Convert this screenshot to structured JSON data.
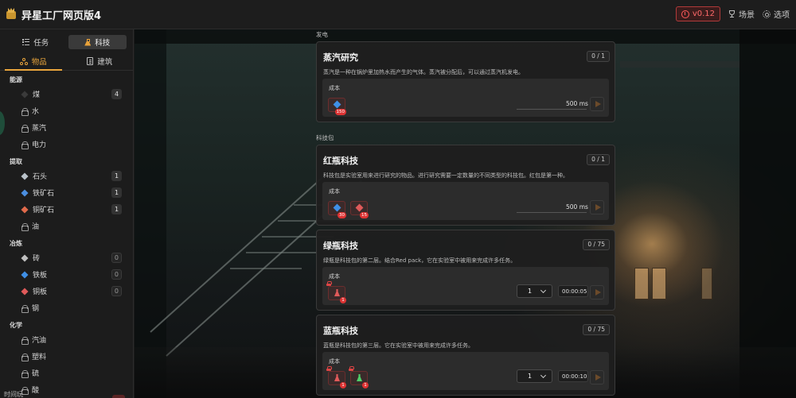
{
  "app": {
    "title": "异星工厂网页版4",
    "version": "v0.12"
  },
  "header": {
    "scenes_label": "场景",
    "options_label": "选项"
  },
  "sidebar": {
    "main_tabs": [
      {
        "label": "任务",
        "icon": "list-icon"
      },
      {
        "label": "科技",
        "icon": "flask-icon",
        "active": true
      }
    ],
    "sub_tabs": [
      {
        "label": "物品",
        "icon": "molecule-icon",
        "active": true
      },
      {
        "label": "建筑",
        "icon": "building-icon"
      }
    ],
    "categories": [
      {
        "name": "能源",
        "items": [
          {
            "name": "煤",
            "count": "4",
            "icon": "coal",
            "color": "#3a3a3a"
          },
          {
            "name": "水",
            "locked": true
          },
          {
            "name": "蒸汽",
            "locked": true
          },
          {
            "name": "电力",
            "locked": true
          }
        ]
      },
      {
        "name": "提取",
        "items": [
          {
            "name": "石头",
            "count": "1",
            "icon": "stone",
            "color": "#b9c2c9"
          },
          {
            "name": "铁矿石",
            "count": "1",
            "icon": "iron-ore",
            "color": "#4b8ee0"
          },
          {
            "name": "铜矿石",
            "count": "1",
            "icon": "copper-ore",
            "color": "#e06a4b"
          },
          {
            "name": "油",
            "locked": true
          }
        ]
      },
      {
        "name": "冶炼",
        "items": [
          {
            "name": "砖",
            "count": "0",
            "icon": "brick",
            "color": "#bfbfbf"
          },
          {
            "name": "铁板",
            "count": "0",
            "icon": "iron-plate",
            "color": "#3f8fe6"
          },
          {
            "name": "铜板",
            "count": "0",
            "icon": "copper-plate",
            "color": "#e05a5a"
          },
          {
            "name": "钢",
            "locked": true
          }
        ]
      },
      {
        "name": "化学",
        "items": [
          {
            "name": "汽油",
            "locked": true
          },
          {
            "name": "塑料",
            "locked": true
          },
          {
            "name": "硫",
            "locked": true
          },
          {
            "name": "酸",
            "locked": true
          }
        ]
      }
    ],
    "bottom_label": "时间玩"
  },
  "sections": [
    {
      "label": "发电",
      "cards": [
        {
          "title": "蒸汽研究",
          "count": "0 / 1",
          "desc": "蒸汽是一种在锅炉里加热水而产生的气体。蒸汽被分配后，可以通过蒸汽机发电。",
          "cost_label": "成本",
          "time": "500 ms",
          "resources": [
            {
              "color": "#3f8fe6",
              "badge": "150"
            }
          ]
        }
      ]
    },
    {
      "label": "科技包",
      "cards": [
        {
          "title": "红瓶科技",
          "count": "0 / 1",
          "desc": "科技包是实验室用来进行研究的物品。进行研究需要一定数量的不同类型的科技包。红包是第一种。",
          "cost_label": "成本",
          "time": "500 ms",
          "resources": [
            {
              "color": "#3f8fe6",
              "badge": "30"
            },
            {
              "color": "#e05a5a",
              "badge": "15"
            }
          ]
        },
        {
          "title": "绿瓶科技",
          "count": "0 / 75",
          "desc": "绿瓶是科技包的第二层。结合Red pack，它在实验室中被用来完成许多任务。",
          "cost_label": "成本",
          "qty": "1",
          "timer": "00:00:05",
          "resources": [
            {
              "color": "#e05a5a",
              "badge": "1",
              "flask": true,
              "locked": true
            }
          ]
        },
        {
          "title": "蓝瓶科技",
          "count": "0 / 75",
          "desc": "蓝瓶是科技包的第三层。它在实验室中被用来完成许多任务。",
          "cost_label": "成本",
          "qty": "1",
          "timer": "00:00:10",
          "resources": [
            {
              "color": "#e05a5a",
              "badge": "1",
              "flask": true,
              "locked": true
            },
            {
              "color": "#4fd06a",
              "badge": "1",
              "flask": true,
              "locked": true
            }
          ]
        }
      ]
    }
  ]
}
